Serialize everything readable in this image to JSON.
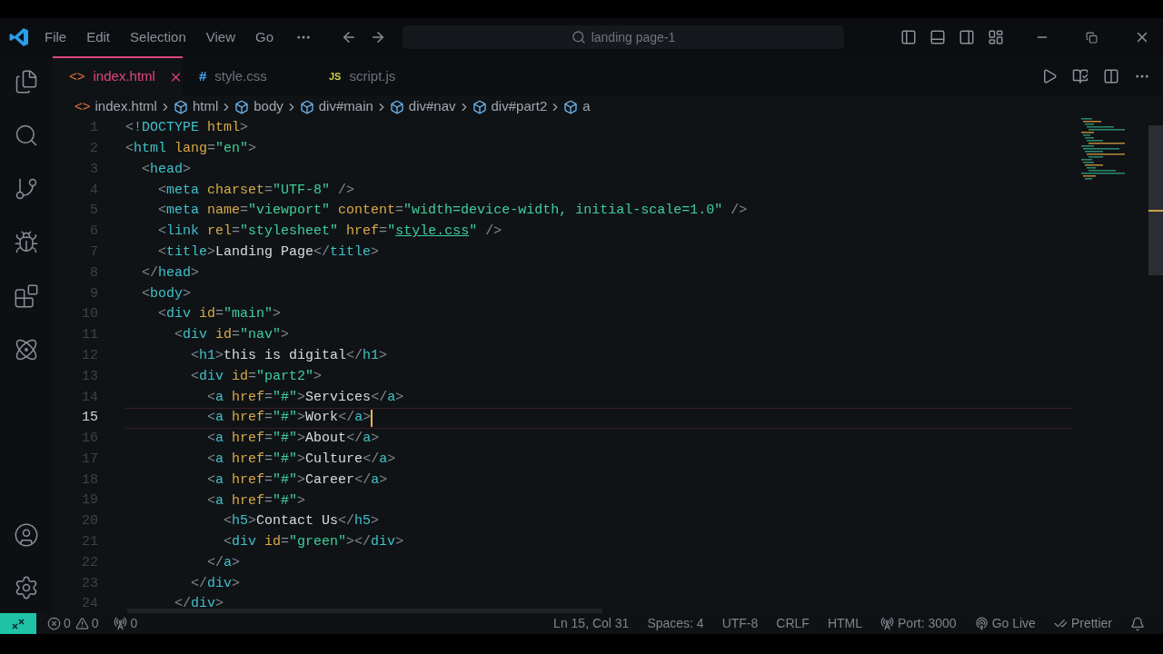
{
  "menu": [
    "File",
    "Edit",
    "Selection",
    "View",
    "Go"
  ],
  "search": {
    "value": "landing page-1"
  },
  "tabs": [
    {
      "icon": "<>",
      "kind": "html",
      "label": "index.html",
      "selected": true
    },
    {
      "icon": "#",
      "kind": "css",
      "label": "style.css",
      "selected": false
    },
    {
      "icon": "JS",
      "kind": "js",
      "label": "script.js",
      "selected": false
    }
  ],
  "breadcrumbs": [
    {
      "kind": "file",
      "icon": "<>",
      "label": "index.html"
    },
    {
      "kind": "element",
      "label": "html"
    },
    {
      "kind": "element",
      "label": "body"
    },
    {
      "kind": "element",
      "label": "div#main"
    },
    {
      "kind": "element",
      "label": "div#nav"
    },
    {
      "kind": "element",
      "label": "div#part2"
    },
    {
      "kind": "element",
      "label": "a"
    }
  ],
  "lines": [
    {
      "number": "1",
      "current": false,
      "tokens": [
        {
          "kind": "punct",
          "text": "<!"
        },
        {
          "kind": "tag",
          "text": "DOCTYPE"
        },
        {
          "kind": "attr",
          "text": " html"
        },
        {
          "kind": "punct",
          "text": ">"
        }
      ]
    },
    {
      "number": "2",
      "current": false,
      "tokens": [
        {
          "kind": "punct",
          "text": "<"
        },
        {
          "kind": "tag",
          "text": "html"
        },
        {
          "kind": "attr",
          "text": " lang"
        },
        {
          "kind": "punct",
          "text": "="
        },
        {
          "kind": "string",
          "text": "\"en\""
        },
        {
          "kind": "punct",
          "text": ">"
        }
      ]
    },
    {
      "number": "3",
      "current": false,
      "tokens": [
        {
          "kind": "punct",
          "text": "  <"
        },
        {
          "kind": "tag",
          "text": "head"
        },
        {
          "kind": "punct",
          "text": ">"
        }
      ]
    },
    {
      "number": "4",
      "current": false,
      "tokens": [
        {
          "kind": "punct",
          "text": "    <"
        },
        {
          "kind": "tag",
          "text": "meta"
        },
        {
          "kind": "attr",
          "text": " charset"
        },
        {
          "kind": "punct",
          "text": "="
        },
        {
          "kind": "string",
          "text": "\"UTF-8\""
        },
        {
          "kind": "punct",
          "text": " />"
        }
      ]
    },
    {
      "number": "5",
      "current": false,
      "tokens": [
        {
          "kind": "punct",
          "text": "    <"
        },
        {
          "kind": "tag",
          "text": "meta"
        },
        {
          "kind": "attr",
          "text": " name"
        },
        {
          "kind": "punct",
          "text": "="
        },
        {
          "kind": "string",
          "text": "\"viewport\""
        },
        {
          "kind": "attr",
          "text": " content"
        },
        {
          "kind": "punct",
          "text": "="
        },
        {
          "kind": "string",
          "text": "\"width=device-width, initial-scale=1.0\""
        },
        {
          "kind": "punct",
          "text": " />"
        }
      ]
    },
    {
      "number": "6",
      "current": false,
      "tokens": [
        {
          "kind": "punct",
          "text": "    <"
        },
        {
          "kind": "tag",
          "text": "link"
        },
        {
          "kind": "attr",
          "text": " rel"
        },
        {
          "kind": "punct",
          "text": "="
        },
        {
          "kind": "string",
          "text": "\"stylesheet\""
        },
        {
          "kind": "attr",
          "text": " href"
        },
        {
          "kind": "punct",
          "text": "="
        },
        {
          "kind": "string",
          "text": "\""
        },
        {
          "kind": "link",
          "text": "style.css"
        },
        {
          "kind": "string",
          "text": "\""
        },
        {
          "kind": "punct",
          "text": " />"
        }
      ]
    },
    {
      "number": "7",
      "current": false,
      "tokens": [
        {
          "kind": "punct",
          "text": "    <"
        },
        {
          "kind": "tag",
          "text": "title"
        },
        {
          "kind": "punct",
          "text": ">"
        },
        {
          "kind": "text",
          "text": "Landing Page"
        },
        {
          "kind": "punct",
          "text": "</"
        },
        {
          "kind": "tag",
          "text": "title"
        },
        {
          "kind": "punct",
          "text": ">"
        }
      ]
    },
    {
      "number": "8",
      "current": false,
      "tokens": [
        {
          "kind": "punct",
          "text": "  </"
        },
        {
          "kind": "tag",
          "text": "head"
        },
        {
          "kind": "punct",
          "text": ">"
        }
      ]
    },
    {
      "number": "9",
      "current": false,
      "tokens": [
        {
          "kind": "punct",
          "text": "  <"
        },
        {
          "kind": "tag",
          "text": "body"
        },
        {
          "kind": "punct",
          "text": ">"
        }
      ]
    },
    {
      "number": "10",
      "current": false,
      "tokens": [
        {
          "kind": "punct",
          "text": "    <"
        },
        {
          "kind": "tag",
          "text": "div"
        },
        {
          "kind": "attr",
          "text": " id"
        },
        {
          "kind": "punct",
          "text": "="
        },
        {
          "kind": "string",
          "text": "\"main\""
        },
        {
          "kind": "punct",
          "text": ">"
        }
      ]
    },
    {
      "number": "11",
      "current": false,
      "tokens": [
        {
          "kind": "punct",
          "text": "      <"
        },
        {
          "kind": "tag",
          "text": "div"
        },
        {
          "kind": "attr",
          "text": " id"
        },
        {
          "kind": "punct",
          "text": "="
        },
        {
          "kind": "string",
          "text": "\"nav\""
        },
        {
          "kind": "punct",
          "text": ">"
        }
      ]
    },
    {
      "number": "12",
      "current": false,
      "tokens": [
        {
          "kind": "punct",
          "text": "        <"
        },
        {
          "kind": "tag",
          "text": "h1"
        },
        {
          "kind": "punct",
          "text": ">"
        },
        {
          "kind": "text",
          "text": "this is digital"
        },
        {
          "kind": "punct",
          "text": "</"
        },
        {
          "kind": "tag",
          "text": "h1"
        },
        {
          "kind": "punct",
          "text": ">"
        }
      ]
    },
    {
      "number": "13",
      "current": false,
      "tokens": [
        {
          "kind": "punct",
          "text": "        <"
        },
        {
          "kind": "tag",
          "text": "div"
        },
        {
          "kind": "attr",
          "text": " id"
        },
        {
          "kind": "punct",
          "text": "="
        },
        {
          "kind": "string",
          "text": "\"part2\""
        },
        {
          "kind": "punct",
          "text": ">"
        }
      ]
    },
    {
      "number": "14",
      "current": false,
      "tokens": [
        {
          "kind": "punct",
          "text": "          <"
        },
        {
          "kind": "tag",
          "text": "a"
        },
        {
          "kind": "attr",
          "text": " href"
        },
        {
          "kind": "punct",
          "text": "="
        },
        {
          "kind": "string",
          "text": "\"#\""
        },
        {
          "kind": "punct",
          "text": ">"
        },
        {
          "kind": "text",
          "text": "Services"
        },
        {
          "kind": "punct",
          "text": "</"
        },
        {
          "kind": "tag",
          "text": "a"
        },
        {
          "kind": "punct",
          "text": ">"
        }
      ]
    },
    {
      "number": "15",
      "current": true,
      "tokens": [
        {
          "kind": "punct",
          "text": "          <"
        },
        {
          "kind": "tag",
          "text": "a"
        },
        {
          "kind": "attr",
          "text": " href"
        },
        {
          "kind": "punct",
          "text": "="
        },
        {
          "kind": "string",
          "text": "\"#\""
        },
        {
          "kind": "punct",
          "text": ">"
        },
        {
          "kind": "text",
          "text": "Work"
        },
        {
          "kind": "punct",
          "text": "</"
        },
        {
          "kind": "tag",
          "text": "a"
        },
        {
          "kind": "punct",
          "text": ">"
        }
      ]
    },
    {
      "number": "16",
      "current": false,
      "tokens": [
        {
          "kind": "punct",
          "text": "          <"
        },
        {
          "kind": "tag",
          "text": "a"
        },
        {
          "kind": "attr",
          "text": " href"
        },
        {
          "kind": "punct",
          "text": "="
        },
        {
          "kind": "string",
          "text": "\"#\""
        },
        {
          "kind": "punct",
          "text": ">"
        },
        {
          "kind": "text",
          "text": "About"
        },
        {
          "kind": "punct",
          "text": "</"
        },
        {
          "kind": "tag",
          "text": "a"
        },
        {
          "kind": "punct",
          "text": ">"
        }
      ]
    },
    {
      "number": "17",
      "current": false,
      "tokens": [
        {
          "kind": "punct",
          "text": "          <"
        },
        {
          "kind": "tag",
          "text": "a"
        },
        {
          "kind": "attr",
          "text": " href"
        },
        {
          "kind": "punct",
          "text": "="
        },
        {
          "kind": "string",
          "text": "\"#\""
        },
        {
          "kind": "punct",
          "text": ">"
        },
        {
          "kind": "text",
          "text": "Culture"
        },
        {
          "kind": "punct",
          "text": "</"
        },
        {
          "kind": "tag",
          "text": "a"
        },
        {
          "kind": "punct",
          "text": ">"
        }
      ]
    },
    {
      "number": "18",
      "current": false,
      "tokens": [
        {
          "kind": "punct",
          "text": "          <"
        },
        {
          "kind": "tag",
          "text": "a"
        },
        {
          "kind": "attr",
          "text": " href"
        },
        {
          "kind": "punct",
          "text": "="
        },
        {
          "kind": "string",
          "text": "\"#\""
        },
        {
          "kind": "punct",
          "text": ">"
        },
        {
          "kind": "text",
          "text": "Career"
        },
        {
          "kind": "punct",
          "text": "</"
        },
        {
          "kind": "tag",
          "text": "a"
        },
        {
          "kind": "punct",
          "text": ">"
        }
      ]
    },
    {
      "number": "19",
      "current": false,
      "tokens": [
        {
          "kind": "punct",
          "text": "          <"
        },
        {
          "kind": "tag",
          "text": "a"
        },
        {
          "kind": "attr",
          "text": " href"
        },
        {
          "kind": "punct",
          "text": "="
        },
        {
          "kind": "string",
          "text": "\"#\""
        },
        {
          "kind": "punct",
          "text": ">"
        }
      ]
    },
    {
      "number": "20",
      "current": false,
      "tokens": [
        {
          "kind": "punct",
          "text": "            <"
        },
        {
          "kind": "tag",
          "text": "h5"
        },
        {
          "kind": "punct",
          "text": ">"
        },
        {
          "kind": "text",
          "text": "Contact Us"
        },
        {
          "kind": "punct",
          "text": "</"
        },
        {
          "kind": "tag",
          "text": "h5"
        },
        {
          "kind": "punct",
          "text": ">"
        }
      ]
    },
    {
      "number": "21",
      "current": false,
      "tokens": [
        {
          "kind": "punct",
          "text": "            <"
        },
        {
          "kind": "tag",
          "text": "div"
        },
        {
          "kind": "attr",
          "text": " id"
        },
        {
          "kind": "punct",
          "text": "="
        },
        {
          "kind": "string",
          "text": "\"green\""
        },
        {
          "kind": "punct",
          "text": "></"
        },
        {
          "kind": "tag",
          "text": "div"
        },
        {
          "kind": "punct",
          "text": ">"
        }
      ]
    },
    {
      "number": "22",
      "current": false,
      "tokens": [
        {
          "kind": "punct",
          "text": "          </"
        },
        {
          "kind": "tag",
          "text": "a"
        },
        {
          "kind": "punct",
          "text": ">"
        }
      ]
    },
    {
      "number": "23",
      "current": false,
      "tokens": [
        {
          "kind": "punct",
          "text": "        </"
        },
        {
          "kind": "tag",
          "text": "div"
        },
        {
          "kind": "punct",
          "text": ">"
        }
      ]
    },
    {
      "number": "24",
      "current": false,
      "tokens": [
        {
          "kind": "punct",
          "text": "      </"
        },
        {
          "kind": "tag",
          "text": "div"
        },
        {
          "kind": "punct",
          "text": ">"
        }
      ]
    }
  ],
  "status_bar": {
    "errors": "0",
    "warnings": "0",
    "ports": "0",
    "position": "Ln 15, Col 31",
    "spaces": "Spaces: 4",
    "encoding": "UTF-8",
    "eol": "CRLF",
    "language": "HTML",
    "port": "Port: 3000",
    "live": "Go Live",
    "formatter": "Prettier"
  }
}
